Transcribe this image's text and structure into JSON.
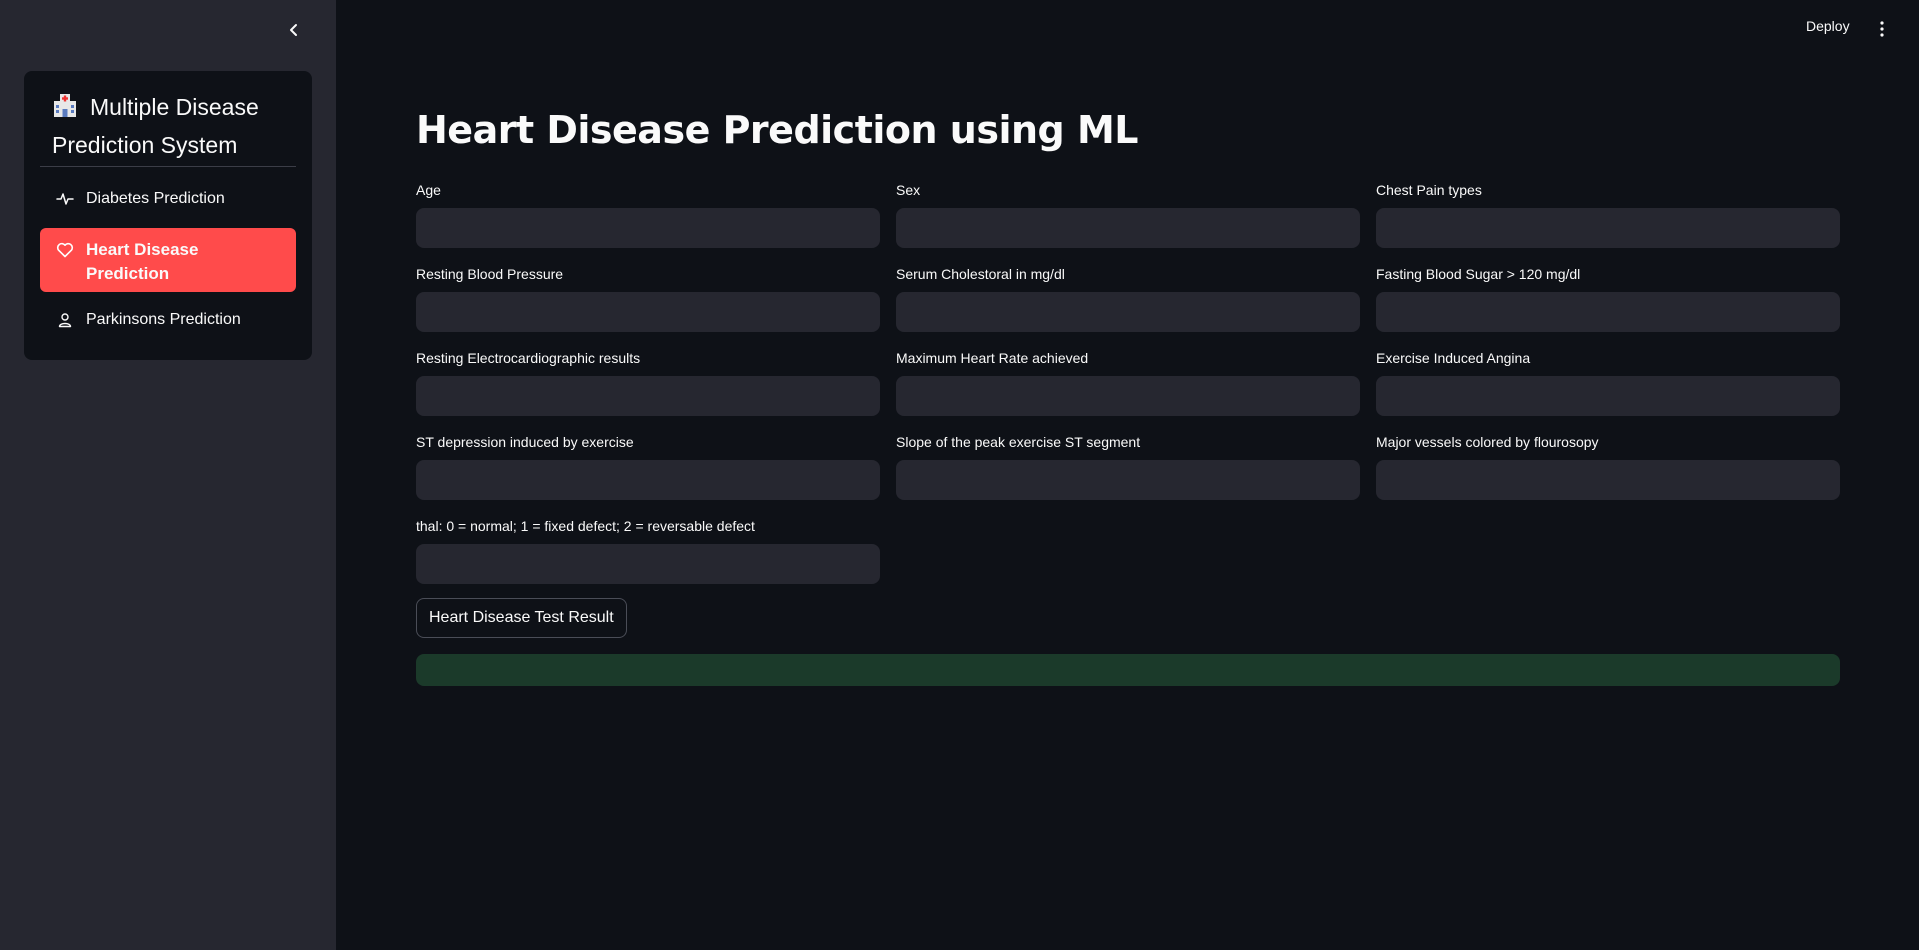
{
  "sidebar": {
    "menu_title": "Multiple Disease Prediction System",
    "items": [
      {
        "label": "Diabetes Prediction",
        "icon": "activity-icon"
      },
      {
        "label": "Heart Disease Prediction",
        "icon": "heart-icon"
      },
      {
        "label": "Parkinsons Prediction",
        "icon": "person-icon"
      }
    ],
    "active_index": 1
  },
  "header": {
    "deploy_label": "Deploy"
  },
  "main": {
    "title": "Heart Disease Prediction using ML",
    "fields": [
      {
        "label": "Age",
        "value": ""
      },
      {
        "label": "Sex",
        "value": ""
      },
      {
        "label": "Chest Pain types",
        "value": ""
      },
      {
        "label": "Resting Blood Pressure",
        "value": ""
      },
      {
        "label": "Serum Cholestoral in mg/dl",
        "value": ""
      },
      {
        "label": "Fasting Blood Sugar > 120 mg/dl",
        "value": ""
      },
      {
        "label": "Resting Electrocardiographic results",
        "value": ""
      },
      {
        "label": "Maximum Heart Rate achieved",
        "value": ""
      },
      {
        "label": "Exercise Induced Angina",
        "value": ""
      },
      {
        "label": "ST depression induced by exercise",
        "value": ""
      },
      {
        "label": "Slope of the peak exercise ST segment",
        "value": ""
      },
      {
        "label": "Major vessels colored by flourosopy",
        "value": ""
      },
      {
        "label": "thal: 0 = normal; 1 = fixed defect; 2 = reversable defect",
        "value": ""
      }
    ],
    "submit_label": "Heart Disease Test Result",
    "result_text": ""
  },
  "colors": {
    "accent": "#ff4b4b",
    "background": "#0e1117",
    "sidebar": "#262730",
    "success": "#1b3a2a"
  }
}
